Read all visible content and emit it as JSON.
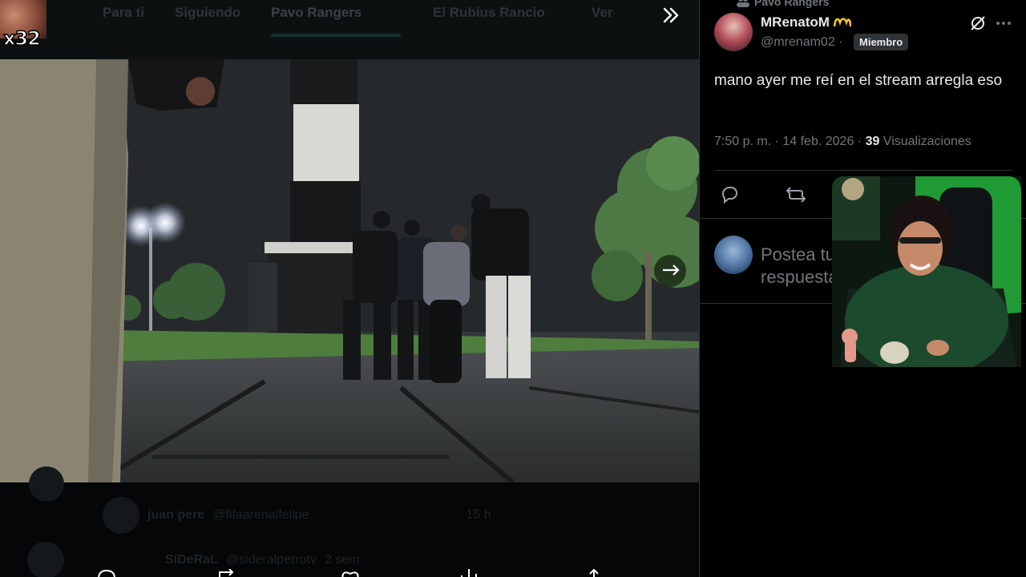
{
  "streamer_overlay": {
    "multiplier": "x32"
  },
  "top_tabs": [
    {
      "label": "Para ti"
    },
    {
      "label": "Siguiendo"
    },
    {
      "label": "Pavo Rangers"
    },
    {
      "label": "El Rubius Rancio"
    },
    {
      "label": "Ver"
    }
  ],
  "below_video": {
    "rows": [
      {
        "name": "juan pere",
        "handle": "@fifaarenalfelipe",
        "time": "15 h"
      },
      {
        "name": "SiDeRaL",
        "handle": "@sideralperrotv",
        "time": "2 sem"
      }
    ]
  },
  "post": {
    "community": "Pavo Rangers",
    "author_name": "MRenatoM",
    "author_handle": "@mrenam02",
    "dot": "·",
    "member_badge": "Miembro",
    "text": "mano ayer me reí en el stream arregla eso",
    "time": "7:50 p. m. · 14 feb. 2026 · ",
    "views_count": "39",
    "views_label": " Visualizaciones",
    "reply_placeholder": "Postea tu respuesta"
  },
  "colors": {
    "background": "#000000",
    "text_primary": "#e7e9ea",
    "text_secondary": "#71767b",
    "divider": "#2f3336",
    "greenscreen": "#1f9a35"
  }
}
